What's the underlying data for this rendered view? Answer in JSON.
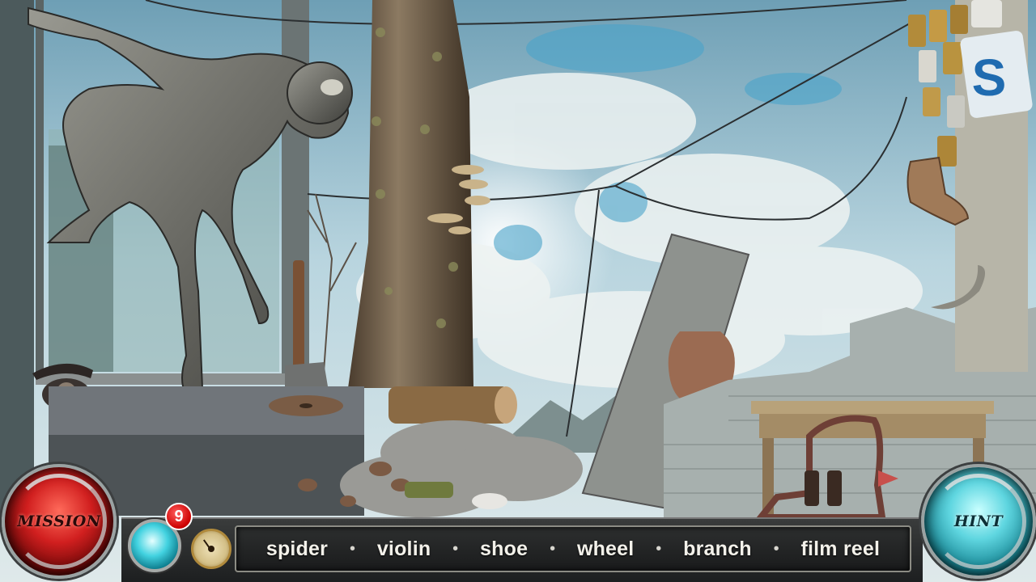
{
  "hud": {
    "mission_label": "MISSION",
    "hint_label": "HINT",
    "found_count": "9"
  },
  "find_list": [
    {
      "word": "spider"
    },
    {
      "word": "violin"
    },
    {
      "word": "shoe"
    },
    {
      "word": "wheel"
    },
    {
      "word": "branch"
    },
    {
      "word": "film reel"
    }
  ],
  "sign": {
    "letter": "S"
  },
  "colors": {
    "mission": "#d11f1f",
    "hint": "#5fd6e0",
    "badge": "#cc0000",
    "sky": "#a9cfdc"
  }
}
